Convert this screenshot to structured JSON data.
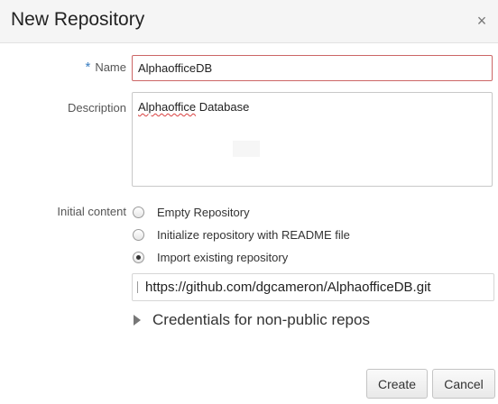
{
  "dialog": {
    "title": "New Repository",
    "close_glyph": "×"
  },
  "form": {
    "required_marker": "*",
    "name_label": "Name",
    "name_value": "AlphaofficeDB",
    "description_label": "Description",
    "description_value": {
      "misspelled_word": "Alphaoffice",
      "rest": " Database"
    },
    "initial_content_label": "Initial content",
    "options": [
      {
        "label": "Empty Repository",
        "checked": false
      },
      {
        "label": "Initialize repository with README file",
        "checked": false
      },
      {
        "label": "Import existing repository",
        "checked": true
      }
    ],
    "import_url": "https://github.com/dgcameron/AlphaofficeDB.git",
    "credentials_label": "Credentials for non-public repos"
  },
  "buttons": {
    "create": "Create",
    "cancel": "Cancel"
  },
  "colors": {
    "header_bg": "#f5f5f5",
    "required_star": "#3a7ec1",
    "name_border_error": "#cc6666"
  },
  "icons": {
    "close": "close-icon",
    "expand": "triangle-right-icon"
  }
}
